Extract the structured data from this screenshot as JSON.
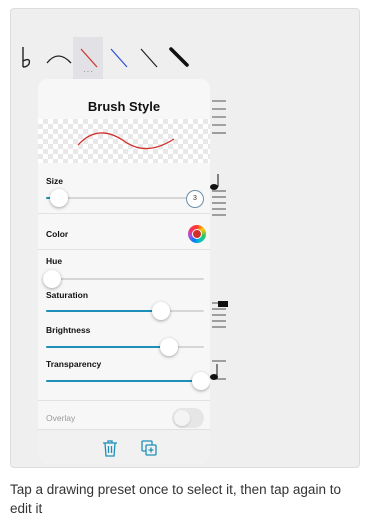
{
  "panel": {
    "title": "Brush Style",
    "size": {
      "label": "Size",
      "value": "3",
      "level": 0.08
    },
    "color": {
      "label": "Color",
      "accent": "#d0302a"
    },
    "hue": {
      "label": "Hue",
      "level": 0.04
    },
    "saturation": {
      "label": "Saturation",
      "level": 0.73
    },
    "brightness": {
      "label": "Brightness",
      "level": 0.78
    },
    "transparency": {
      "label": "Transparency",
      "level": 0.98
    },
    "overlay": {
      "label": "Overlay",
      "on": false
    }
  },
  "toolbar": {
    "icons": [
      "flat-sign-icon",
      "arc-line-icon",
      "red-line-icon",
      "blue-line-icon",
      "black-line-icon",
      "thick-line-icon"
    ],
    "selected": 2
  },
  "footer": {
    "icons": [
      "trash-icon",
      "duplicate-icon"
    ]
  },
  "colors": {
    "accent": "#1e8fb8",
    "brush_red": "#d0302a",
    "brush_blue": "#2c4fd6"
  },
  "caption": "Tap a drawing preset once to select it, then tap again to edit it"
}
